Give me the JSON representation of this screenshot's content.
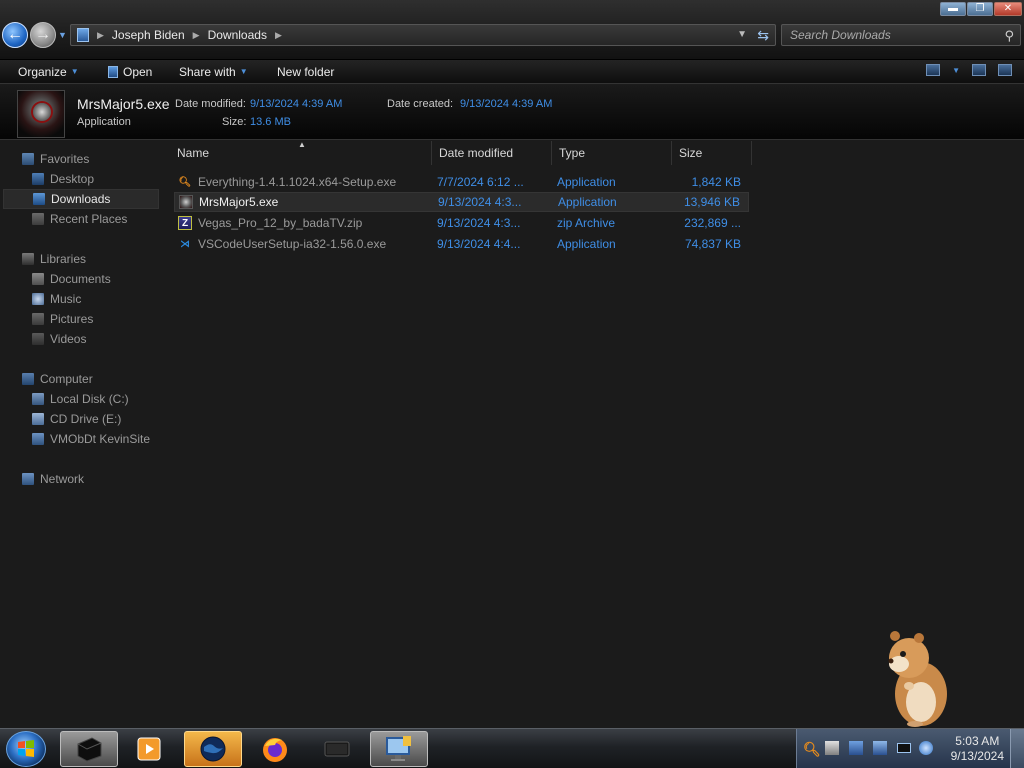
{
  "window": {
    "controls": [
      "minimize",
      "maximize",
      "close"
    ]
  },
  "address": {
    "crumbs": [
      "Joseph Biden",
      "Downloads"
    ]
  },
  "search": {
    "placeholder": "Search Downloads"
  },
  "commandbar": {
    "organize": "Organize",
    "open": "Open",
    "share_with": "Share with",
    "new_folder": "New folder"
  },
  "details": {
    "file_name": "MrsMajor5.exe",
    "file_type": "Application",
    "date_modified_label": "Date modified:",
    "date_modified": "9/13/2024 4:39 AM",
    "date_created_label": "Date created:",
    "date_created": "9/13/2024 4:39 AM",
    "size_label": "Size:",
    "size": "13.6 MB"
  },
  "navpane": {
    "favorites": "Favorites",
    "desktop": "Desktop",
    "downloads": "Downloads",
    "recent": "Recent Places",
    "libraries": "Libraries",
    "documents": "Documents",
    "music": "Music",
    "pictures": "Pictures",
    "videos": "Videos",
    "computer": "Computer",
    "local_disk": "Local Disk (C:)",
    "cd_drive": "CD Drive (E:)",
    "share": "VMObDt KevinSite",
    "network": "Network"
  },
  "columns": {
    "name": "Name",
    "date": "Date modified",
    "type": "Type",
    "size": "Size"
  },
  "files": [
    {
      "name": "Everything-1.4.1.1024.x64-Setup.exe",
      "date": "7/7/2024 6:12 ...",
      "type": "Application",
      "size": "1,842 KB",
      "icon": "magnifier-icon"
    },
    {
      "name": "MrsMajor5.exe",
      "date": "9/13/2024 4:3...",
      "type": "Application",
      "size": "13,946 KB",
      "icon": "exe-icon"
    },
    {
      "name": "Vegas_Pro_12_by_badaTV.zip",
      "date": "9/13/2024 4:3...",
      "type": "zip Archive",
      "size": "232,869 ...",
      "icon": "zip-icon"
    },
    {
      "name": "VSCodeUserSetup-ia32-1.56.0.exe",
      "date": "9/13/2024 4:4...",
      "type": "Application",
      "size": "74,837 KB",
      "icon": "vscode-icon"
    }
  ],
  "taskbar": {
    "items": [
      "explorer-icon",
      "media-player-icon",
      "browser-globe-icon",
      "firefox-icon",
      "terminal-icon",
      "computer-icon"
    ]
  },
  "clock": {
    "time": "5:03 AM",
    "date": "9/13/2024"
  }
}
